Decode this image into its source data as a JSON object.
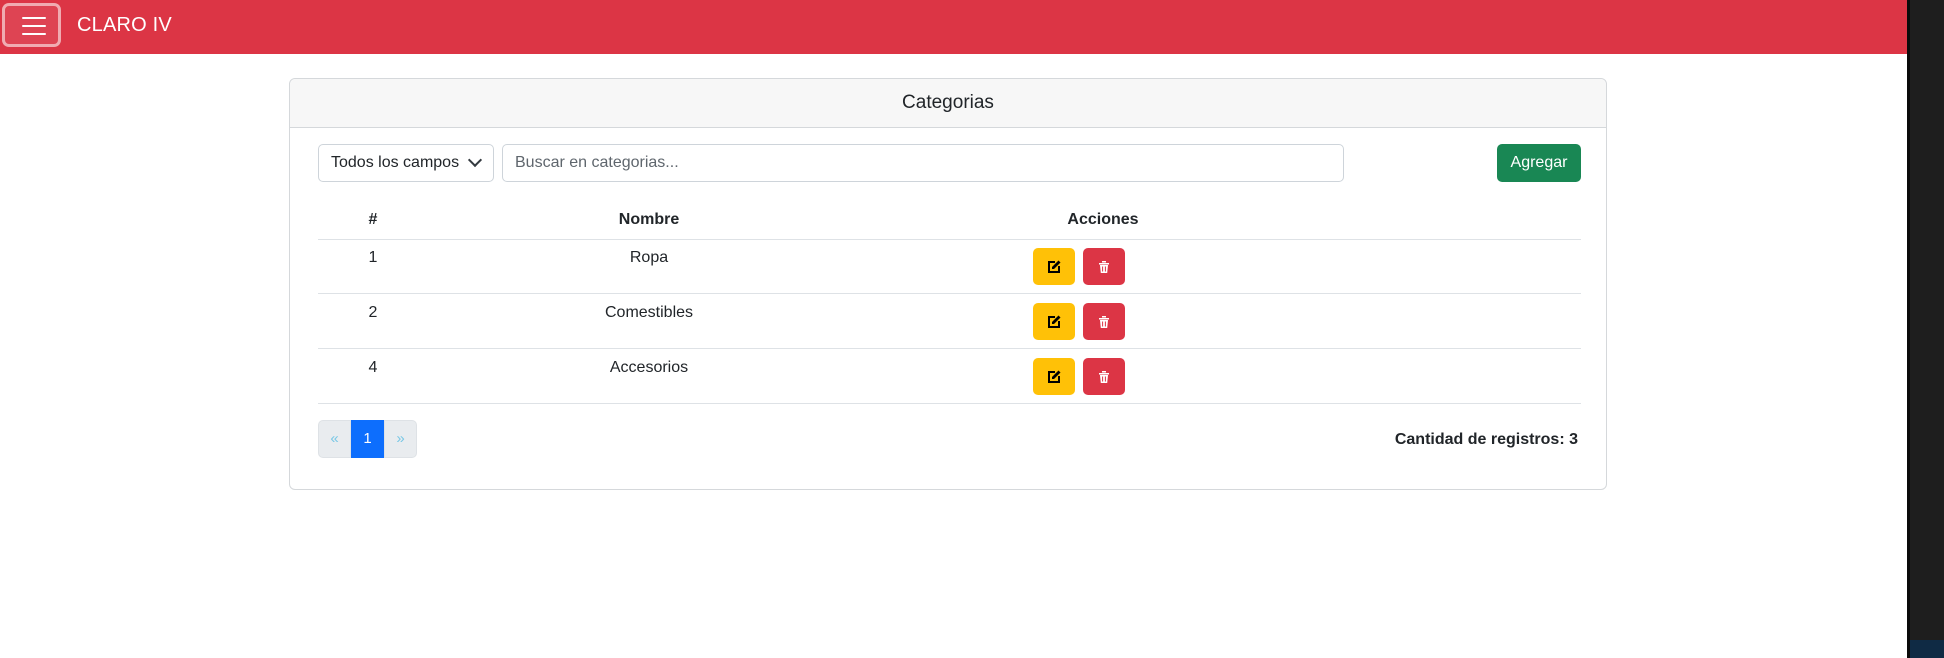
{
  "navbar": {
    "brand": "CLARO IV",
    "color": "#dc3545"
  },
  "card": {
    "title": "Categorias"
  },
  "filter": {
    "selected": "Todos los campos",
    "search_placeholder": "Buscar en categorias...",
    "add_label": "Agregar"
  },
  "table": {
    "headers": [
      "#",
      "Nombre",
      "Acciones"
    ],
    "rows": [
      {
        "id": "1",
        "name": "Ropa"
      },
      {
        "id": "2",
        "name": "Comestibles"
      },
      {
        "id": "4",
        "name": "Accesorios"
      }
    ],
    "actions": [
      {
        "icon": "edit-icon",
        "color": "#ffc107"
      },
      {
        "icon": "trash-icon",
        "color": "#dc3545"
      }
    ]
  },
  "pagination": {
    "prev": "«",
    "current": "1",
    "next": "»"
  },
  "footer": {
    "count_label": "Cantidad de registros: 3"
  }
}
